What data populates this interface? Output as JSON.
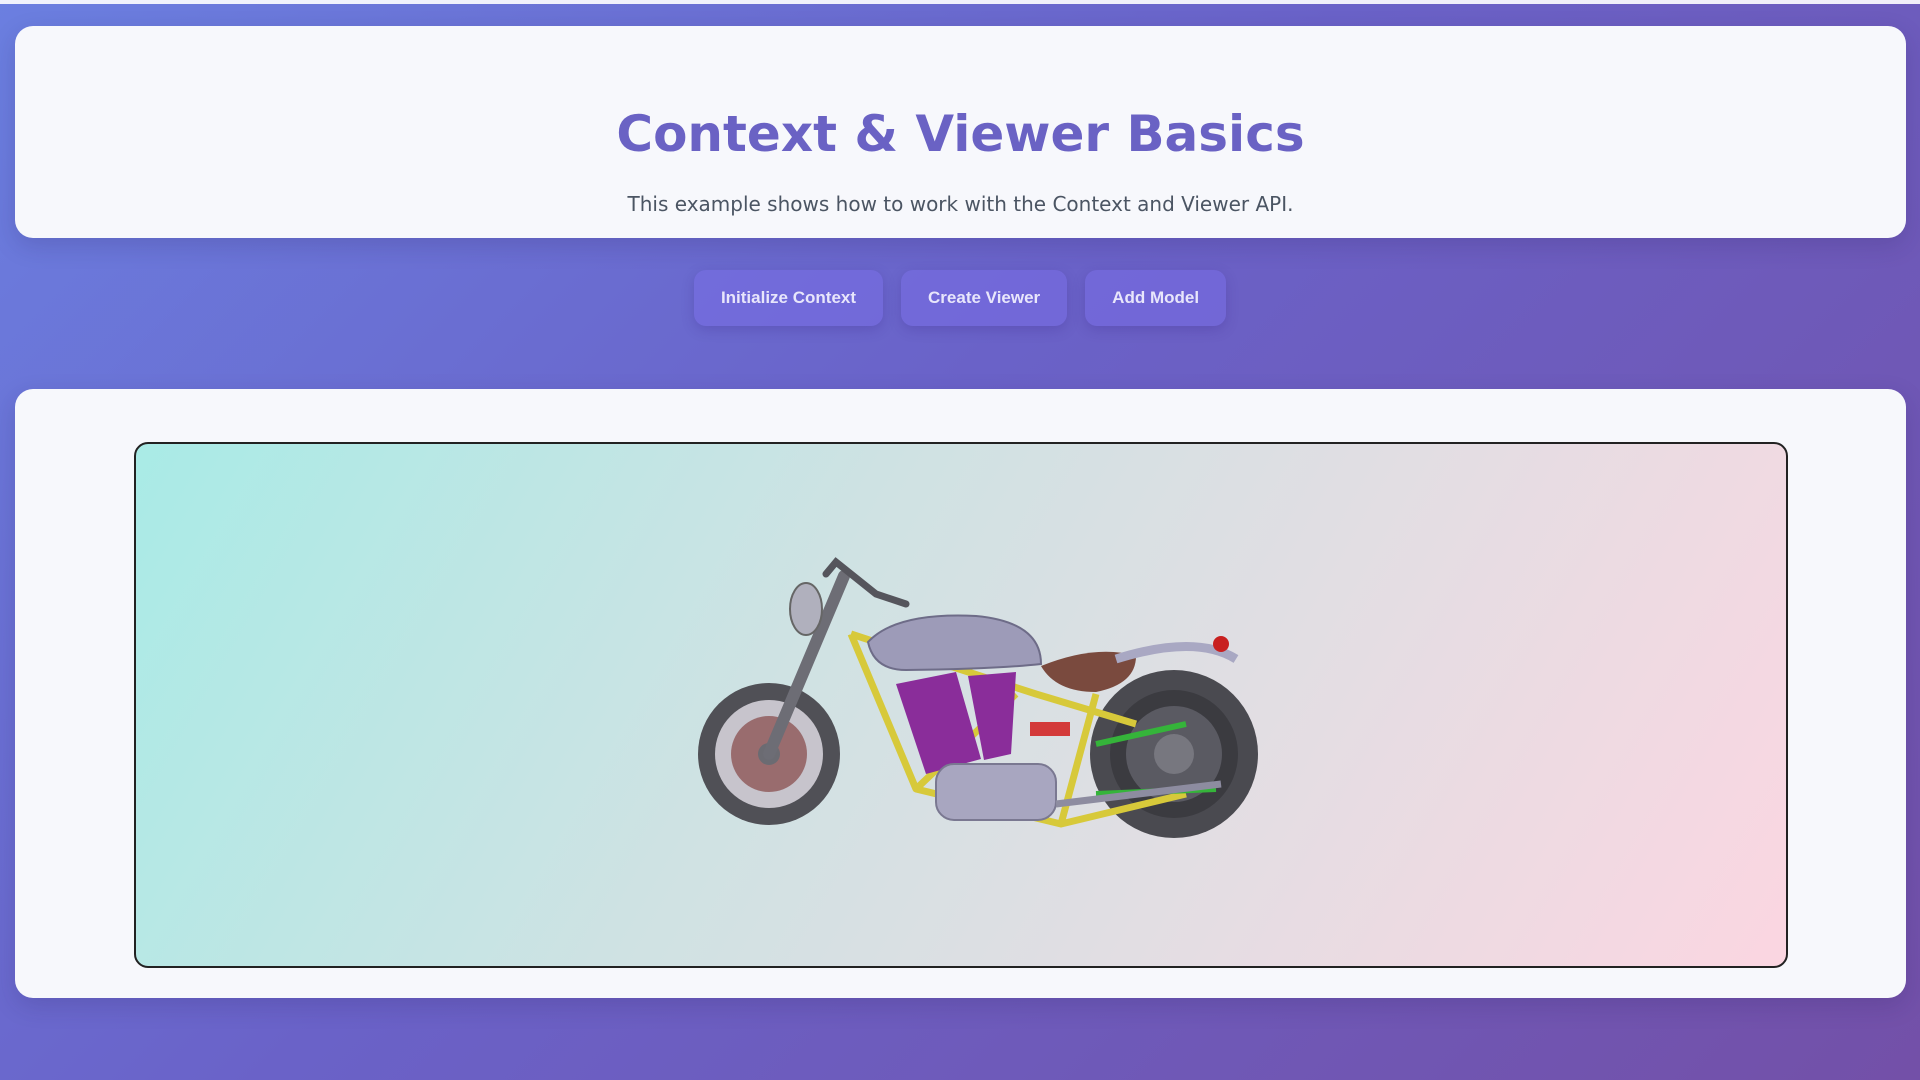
{
  "header": {
    "title": "Context & Viewer Basics",
    "subtitle": "This example shows how to work with the Context and Viewer API."
  },
  "toolbar": {
    "buttons": [
      {
        "label": "Initialize Context"
      },
      {
        "label": "Create Viewer"
      },
      {
        "label": "Add Model"
      }
    ]
  },
  "viewer": {
    "model": "motorcycle-model"
  },
  "colors": {
    "title": "#6a62c4",
    "button_bg": "#786ee6",
    "canvas_gradient_start": "#a9ebe6",
    "canvas_gradient_end": "#fbd6e1"
  }
}
